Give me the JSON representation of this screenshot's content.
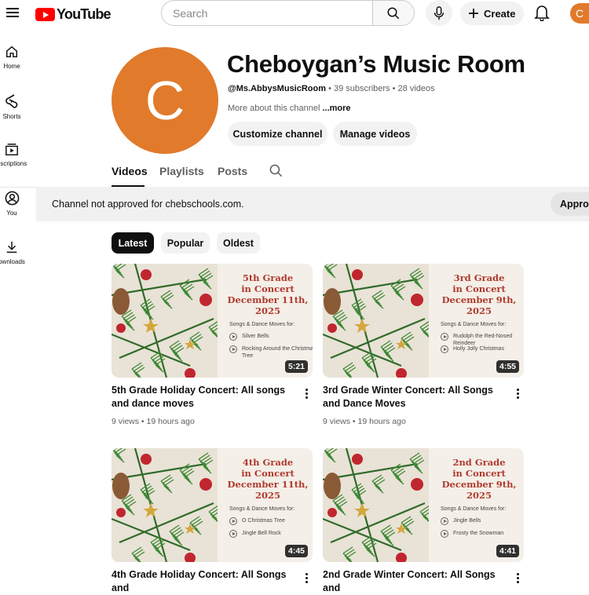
{
  "topbar": {
    "logo_text": "YouTube",
    "search_placeholder": "Search",
    "create_label": "Create",
    "account_initial": "C"
  },
  "sidebar": {
    "items": [
      {
        "label": "Home",
        "icon": "home-icon"
      },
      {
        "label": "Shorts",
        "icon": "shorts-icon"
      },
      {
        "label": "bscriptions",
        "icon": "subscriptions-icon"
      },
      {
        "label": "You",
        "icon": "you-icon"
      },
      {
        "label": "ownloads",
        "icon": "download-icon"
      }
    ]
  },
  "channel": {
    "avatar_initial": "C",
    "title": "Cheboygan’s Music Room",
    "handle": "@Ms.AbbysMusicRoom",
    "subscribers": "39 subscribers",
    "videos_count": "28 videos",
    "about": "More about this channel",
    "more_label": "...more",
    "customize_label": "Customize channel",
    "manage_label": "Manage videos"
  },
  "tabs": [
    {
      "label": "Videos",
      "active": true
    },
    {
      "label": "Playlists",
      "active": false
    },
    {
      "label": "Posts",
      "active": false
    }
  ],
  "banner": {
    "text": "Channel not approved for chebschools.com.",
    "button_label": "Approv"
  },
  "chips": [
    {
      "label": "Latest",
      "selected": true
    },
    {
      "label": "Popular",
      "selected": false
    },
    {
      "label": "Oldest",
      "selected": false
    }
  ],
  "videos": [
    {
      "thumb_title": [
        "5th Grade",
        "in Concert",
        "December 11th,",
        "2025"
      ],
      "intro": "Songs & Dance Moves for:",
      "songs": [
        "Silver Bells",
        "Rocking Around the Christmas Tree"
      ],
      "duration": "5:21",
      "title": "5th Grade Holiday Concert: All songs and dance moves",
      "meta": "9 views • 19 hours ago"
    },
    {
      "thumb_title": [
        "3rd Grade",
        "in Concert",
        "December 9th,",
        "2025"
      ],
      "intro": "Songs & Dance Moves for:",
      "songs": [
        "Rudolph the Red-Nosed Reindeer",
        "Holly Jolly Christmas"
      ],
      "duration": "4:55",
      "title": "3rd Grade Winter Concert: All Songs and Dance Moves",
      "meta": "9 views • 19 hours ago"
    },
    {
      "thumb_title": [
        "4th Grade",
        "in Concert",
        "December 11th,",
        "2025"
      ],
      "intro": "Songs & Dance Moves for:",
      "songs": [
        "O Christmas Tree",
        "Jingle Bell Rock"
      ],
      "duration": "4:45",
      "title": "4th Grade Holiday Concert: All Songs and",
      "meta": ""
    },
    {
      "thumb_title": [
        "2nd Grade",
        "in Concert",
        "December 9th,",
        "2025"
      ],
      "intro": "Songs & Dance Moves for:",
      "songs": [
        "Jingle Bells",
        "Frosty the Snowman"
      ],
      "duration": "4:41",
      "title": "2nd Grade Winter Concert: All Songs and",
      "meta": ""
    }
  ],
  "colors": {
    "brand_red": "#ff0000",
    "avatar_orange": "#e17a2b",
    "thumb_title_red": "#b03a2e"
  }
}
